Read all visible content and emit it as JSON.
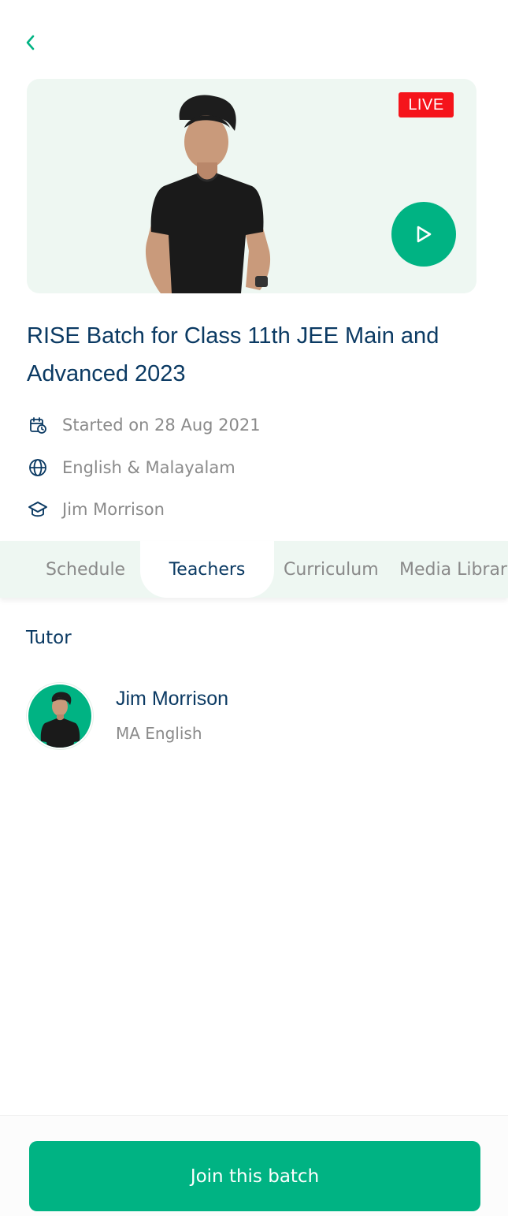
{
  "header": {
    "back_icon": "chevron-left-icon"
  },
  "hero": {
    "live_label": "LIVE",
    "play_icon": "play-icon",
    "accent_color": "#00b383",
    "live_color": "#f5141b"
  },
  "batch": {
    "title": "RISE Batch for Class 11th JEE Main and Advanced 2023",
    "meta": {
      "start_date": "Started on 28 Aug  2021",
      "languages": "English & Malayalam",
      "teacher": "Jim Morrison"
    }
  },
  "tabs": [
    {
      "label": "Schedule",
      "active": false
    },
    {
      "label": "Teachers",
      "active": true
    },
    {
      "label": "Curriculum",
      "active": false
    },
    {
      "label": "Media Library",
      "active": false
    }
  ],
  "teachers_section": {
    "heading": "Tutor",
    "tutors": [
      {
        "name": "Jim Morrison",
        "qualification": "MA English"
      }
    ]
  },
  "footer": {
    "join_label": "Join this batch"
  },
  "colors": {
    "primary": "#00b383",
    "title": "#0b3a63",
    "muted": "#8a8a8a",
    "tint": "#eef7f2"
  }
}
